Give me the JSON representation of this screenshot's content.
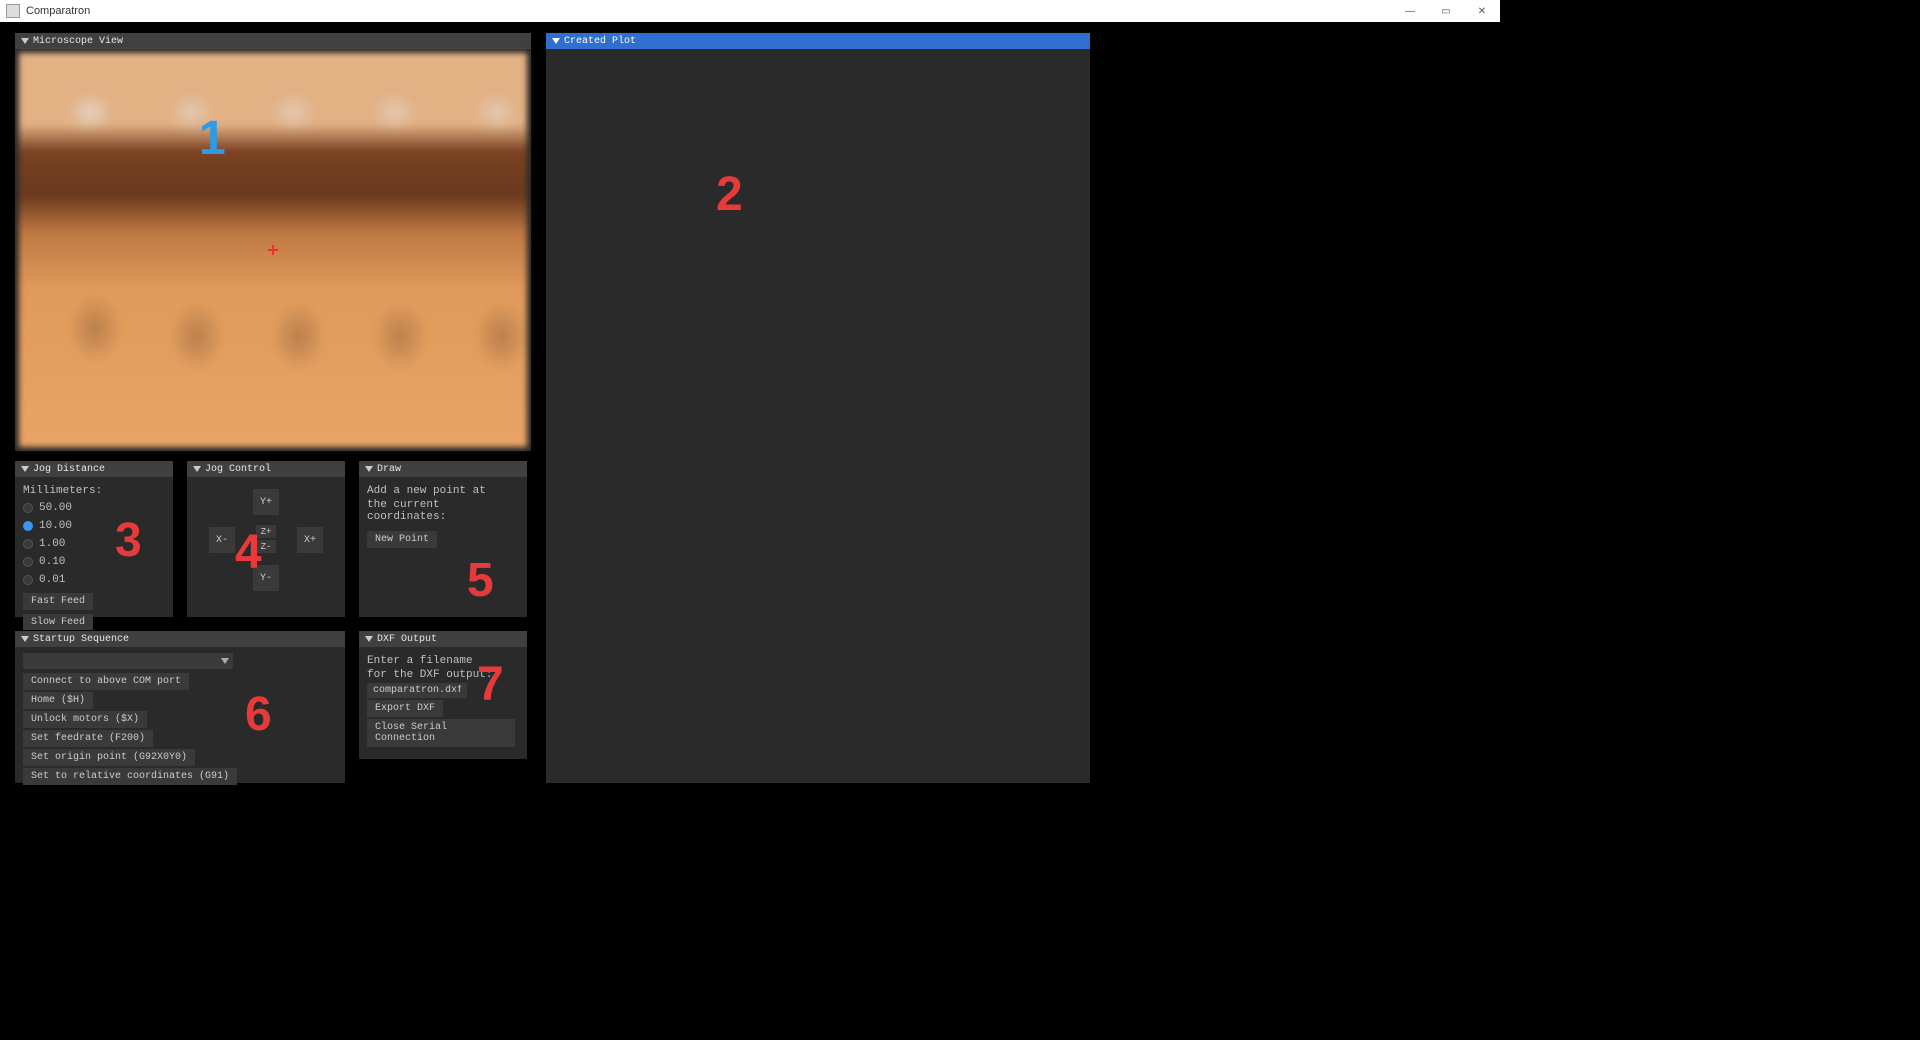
{
  "window": {
    "title": "Comparatron"
  },
  "panels": {
    "microscope": {
      "title": "Microscope View"
    },
    "plot": {
      "title": "Created Plot"
    },
    "jog_distance": {
      "title": "Jog Distance",
      "label": "Millimeters:",
      "options": [
        "50.00",
        "10.00",
        "1.00",
        "0.10",
        "0.01"
      ],
      "selected": 1,
      "fast_feed": "Fast Feed",
      "slow_feed": "Slow Feed"
    },
    "jog_control": {
      "title": "Jog Control",
      "yp": "Y+",
      "ym": "Y-",
      "xp": "X+",
      "xm": "X-",
      "zp": "Z+",
      "zm": "Z-"
    },
    "draw": {
      "title": "Draw",
      "line1": "Add a new point at",
      "line2": "the current coordinates:",
      "new_point": "New Point"
    },
    "startup": {
      "title": "Startup Sequence",
      "items": [
        "Connect to above COM port",
        "Home ($H)",
        "Unlock motors ($X)",
        "Set feedrate (F200)",
        "Set origin point (G92X0Y0)",
        "Set to relative coordinates (G91)"
      ]
    },
    "dxf": {
      "title": "DXF Output",
      "line1": "Enter a filename",
      "line2": "for the DXF output:",
      "filename": "comparatron.dxf",
      "export": "Export DXF",
      "close": "Close Serial Connection"
    }
  },
  "overlays": {
    "n1": "1",
    "n2": "2",
    "n3": "3",
    "n4": "4",
    "n5": "5",
    "n6": "6",
    "n7": "7"
  }
}
